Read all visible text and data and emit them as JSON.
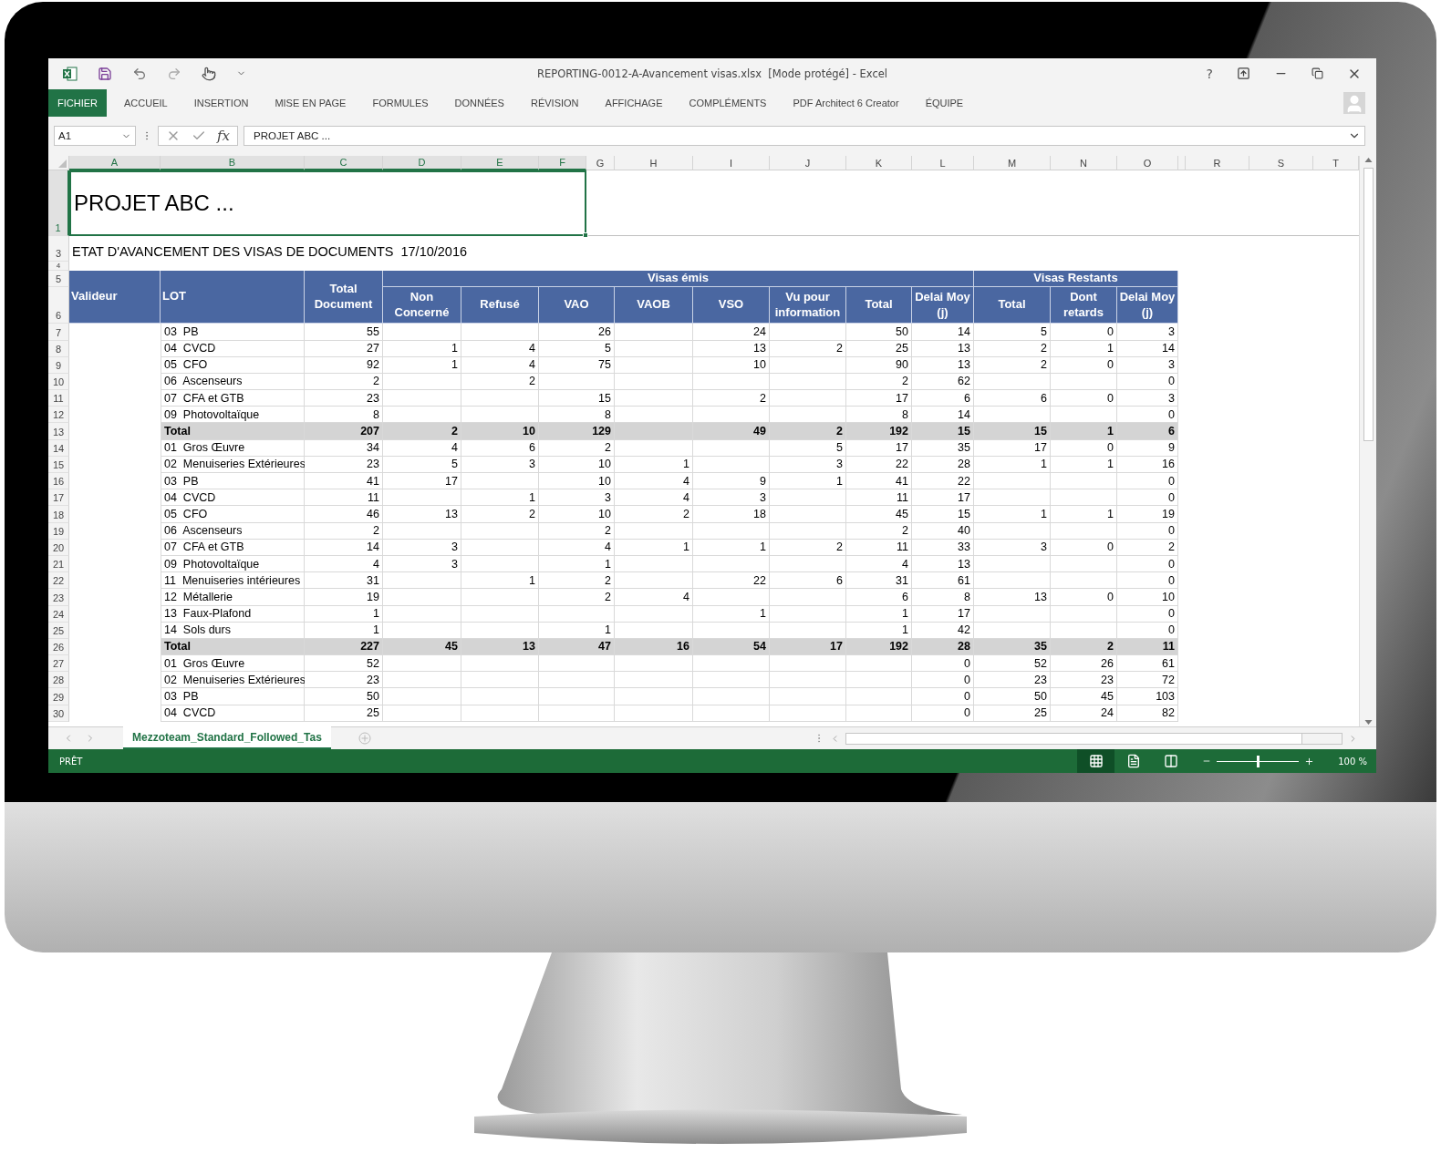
{
  "window": {
    "title": "REPORTING-0012-A-Avancement visas.xlsx  [Mode protégé] - Excel",
    "help": "?"
  },
  "ribbon_tabs": [
    {
      "label": "FICHIER",
      "kind": "file"
    },
    {
      "label": "ACCUEIL",
      "kind": "tab"
    },
    {
      "label": "INSERTION",
      "kind": "tab"
    },
    {
      "label": "MISE EN PAGE",
      "kind": "tab"
    },
    {
      "label": "FORMULES",
      "kind": "tab"
    },
    {
      "label": "DONNÉES",
      "kind": "tab"
    },
    {
      "label": "RÉVISION",
      "kind": "tab"
    },
    {
      "label": "AFFICHAGE",
      "kind": "tab"
    },
    {
      "label": "COMPLÉMENTS",
      "kind": "tab"
    },
    {
      "label": "PDF Architect 6 Creator",
      "kind": "tab"
    },
    {
      "label": "ÉQUIPE",
      "kind": "tab"
    }
  ],
  "formula_bar": {
    "name_box": "A1",
    "function_label": "fx",
    "value": "PROJET ABC ..."
  },
  "columns": [
    {
      "label": "A",
      "selected": true
    },
    {
      "label": "B",
      "selected": true
    },
    {
      "label": "C",
      "selected": true
    },
    {
      "label": "D",
      "selected": true
    },
    {
      "label": "E",
      "selected": true
    },
    {
      "label": "F",
      "selected": true
    },
    {
      "label": "G",
      "selected": false
    },
    {
      "label": "H",
      "selected": false
    },
    {
      "label": "I",
      "selected": false
    },
    {
      "label": "J",
      "selected": false
    },
    {
      "label": "K",
      "selected": false
    },
    {
      "label": "L",
      "selected": false
    },
    {
      "label": "M",
      "selected": false
    },
    {
      "label": "N",
      "selected": false
    },
    {
      "label": "O",
      "selected": false
    },
    {
      "label": "R",
      "selected": false
    },
    {
      "label": "S",
      "selected": false
    },
    {
      "label": "T",
      "selected": false
    }
  ],
  "sheet": {
    "title_row": {
      "number": "1",
      "selected": true,
      "text": "PROJET ABC ..."
    },
    "subtitle_row": {
      "number": "3",
      "text": "ETAT D'AVANCEMENT DES VISAS DE DOCUMENTS  17/10/2016"
    },
    "blank_row": {
      "number": "4"
    },
    "table": {
      "header_numbers": [
        "5",
        "6"
      ],
      "headers": [
        "Valideur",
        "LOT",
        "Total Document"
      ],
      "groups": [
        {
          "label": "Visas émis",
          "columns": [
            "Non Concerné",
            "Refusé",
            "VAO",
            "VAOB",
            "VSO",
            "Vu pour information",
            "Total",
            "Delai Moy (j)"
          ]
        },
        {
          "label": "Visas Restants",
          "columns": [
            "Total",
            "Dont retards",
            "Delai Moy (j)"
          ]
        }
      ],
      "rows": [
        {
          "number": "7",
          "kind": "item",
          "lot": "03  PB",
          "values": {
            "C": "55",
            "F": "26",
            "I": "24",
            "K": "50",
            "L": "14",
            "M": "5",
            "N": "0",
            "O": "3"
          }
        },
        {
          "number": "8",
          "kind": "item",
          "lot": "04  CVCD",
          "values": {
            "C": "27",
            "D": "1",
            "E": "4",
            "F": "5",
            "I": "13",
            "J": "2",
            "K": "25",
            "L": "13",
            "M": "2",
            "N": "1",
            "O": "14"
          }
        },
        {
          "number": "9",
          "kind": "item",
          "lot": "05  CFO",
          "values": {
            "C": "92",
            "D": "1",
            "E": "4",
            "F": "75",
            "I": "10",
            "K": "90",
            "L": "13",
            "M": "2",
            "N": "0",
            "O": "3"
          }
        },
        {
          "number": "10",
          "kind": "item",
          "lot": "06  Ascenseurs",
          "values": {
            "C": "2",
            "E": "2",
            "K": "2",
            "L": "62",
            "O": "0"
          }
        },
        {
          "number": "11",
          "kind": "item",
          "lot": "07  CFA et GTB",
          "values": {
            "C": "23",
            "F": "15",
            "I": "2",
            "K": "17",
            "L": "6",
            "M": "6",
            "N": "0",
            "O": "3"
          }
        },
        {
          "number": "12",
          "kind": "item",
          "lot": "09  Photovoltaïque",
          "values": {
            "C": "8",
            "F": "8",
            "K": "8",
            "L": "14",
            "O": "0"
          }
        },
        {
          "number": "13",
          "kind": "total",
          "lot": "Total",
          "values": {
            "C": "207",
            "D": "2",
            "E": "10",
            "F": "129",
            "I": "49",
            "J": "2",
            "K": "192",
            "L": "15",
            "M": "15",
            "N": "1",
            "O": "6"
          }
        },
        {
          "number": "14",
          "kind": "item",
          "lot": "01  Gros Œuvre",
          "values": {
            "C": "34",
            "D": "4",
            "E": "6",
            "F": "2",
            "J": "5",
            "K": "17",
            "L": "35",
            "M": "17",
            "N": "0",
            "O": "9"
          }
        },
        {
          "number": "15",
          "kind": "item",
          "lot": "02  Menuiseries Extérieures",
          "values": {
            "C": "23",
            "D": "5",
            "E": "3",
            "F": "10",
            "H": "1",
            "J": "3",
            "K": "22",
            "L": "28",
            "M": "1",
            "N": "1",
            "O": "16"
          }
        },
        {
          "number": "16",
          "kind": "item",
          "lot": "03  PB",
          "values": {
            "C": "41",
            "D": "17",
            "F": "10",
            "H": "4",
            "I": "9",
            "J": "1",
            "K": "41",
            "L": "22",
            "O": "0"
          }
        },
        {
          "number": "17",
          "kind": "item",
          "lot": "04  CVCD",
          "values": {
            "C": "11",
            "E": "1",
            "F": "3",
            "H": "4",
            "I": "3",
            "K": "11",
            "L": "17",
            "O": "0"
          }
        },
        {
          "number": "18",
          "kind": "item",
          "lot": "05  CFO",
          "values": {
            "C": "46",
            "D": "13",
            "E": "2",
            "F": "10",
            "H": "2",
            "I": "18",
            "K": "45",
            "L": "15",
            "M": "1",
            "N": "1",
            "O": "19"
          }
        },
        {
          "number": "19",
          "kind": "item",
          "lot": "06  Ascenseurs",
          "values": {
            "C": "2",
            "F": "2",
            "K": "2",
            "L": "40",
            "O": "0"
          }
        },
        {
          "number": "20",
          "kind": "item",
          "lot": "07  CFA et GTB",
          "values": {
            "C": "14",
            "D": "3",
            "F": "4",
            "H": "1",
            "I": "1",
            "J": "2",
            "K": "11",
            "L": "33",
            "M": "3",
            "N": "0",
            "O": "2"
          }
        },
        {
          "number": "21",
          "kind": "item",
          "lot": "09  Photovoltaïque",
          "values": {
            "C": "4",
            "D": "3",
            "F": "1",
            "K": "4",
            "L": "13",
            "O": "0"
          }
        },
        {
          "number": "22",
          "kind": "item",
          "lot": "11  Menuiseries intérieures",
          "values": {
            "C": "31",
            "E": "1",
            "F": "2",
            "I": "22",
            "J": "6",
            "K": "31",
            "L": "61",
            "O": "0"
          }
        },
        {
          "number": "23",
          "kind": "item",
          "lot": "12  Métallerie",
          "values": {
            "C": "19",
            "F": "2",
            "H": "4",
            "K": "6",
            "L": "8",
            "M": "13",
            "N": "0",
            "O": "10"
          }
        },
        {
          "number": "24",
          "kind": "item",
          "lot": "13  Faux-Plafond",
          "values": {
            "C": "1",
            "I": "1",
            "K": "1",
            "L": "17",
            "O": "0"
          }
        },
        {
          "number": "25",
          "kind": "item",
          "lot": "14  Sols durs",
          "values": {
            "C": "1",
            "F": "1",
            "K": "1",
            "L": "42",
            "O": "0"
          }
        },
        {
          "number": "26",
          "kind": "total",
          "lot": "Total",
          "values": {
            "C": "227",
            "D": "45",
            "E": "13",
            "F": "47",
            "H": "16",
            "I": "54",
            "J": "17",
            "K": "192",
            "L": "28",
            "M": "35",
            "N": "2",
            "O": "11"
          }
        },
        {
          "number": "27",
          "kind": "item",
          "lot": "01  Gros Œuvre",
          "values": {
            "C": "52",
            "L": "0",
            "M": "52",
            "N": "26",
            "O": "61"
          }
        },
        {
          "number": "28",
          "kind": "item",
          "lot": "02  Menuiseries Extérieures",
          "values": {
            "C": "23",
            "L": "0",
            "M": "23",
            "N": "23",
            "O": "72"
          }
        },
        {
          "number": "29",
          "kind": "item",
          "lot": "03  PB",
          "values": {
            "C": "50",
            "L": "0",
            "M": "50",
            "N": "45",
            "O": "103"
          }
        },
        {
          "number": "30",
          "kind": "item",
          "lot": "04  CVCD",
          "values": {
            "C": "25",
            "L": "0",
            "M": "25",
            "N": "24",
            "O": "82"
          }
        }
      ]
    }
  },
  "sheet_tabs": [
    {
      "label": "Mezzoteam_Standard_Followed_Tas",
      "selected": true
    }
  ],
  "status_bar": {
    "status": "PRÊT",
    "views": [
      {
        "kind": "normal",
        "selected": true
      },
      {
        "kind": "page_layout",
        "selected": false
      },
      {
        "kind": "page_break",
        "selected": false
      }
    ],
    "zoom": {
      "level": 0.5,
      "reading": "100 %"
    }
  }
}
